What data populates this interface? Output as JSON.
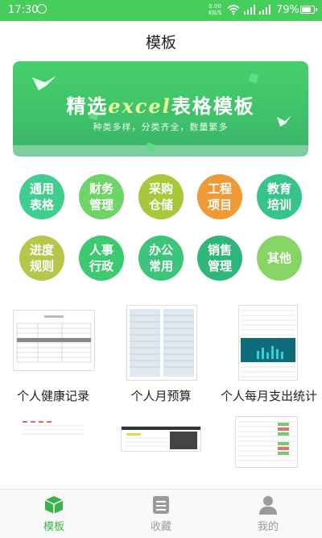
{
  "status": {
    "time": "17:30",
    "net_speed_num": "0.00",
    "net_speed_unit": "KB/S",
    "battery": "79%",
    "battery_level": 0.79
  },
  "header": {
    "title": "模板"
  },
  "banner": {
    "title_a": "精选",
    "title_b": "excel",
    "title_c": "表格模板",
    "subtitle": "种类多样，分类齐全，数量繁多"
  },
  "categories": [
    {
      "label": "通用\n表格",
      "color": "#3fce8d"
    },
    {
      "label": "财务\n管理",
      "color": "#6fd468"
    },
    {
      "label": "采购\n仓储",
      "color": "#a6c93b"
    },
    {
      "label": "工程\n项目",
      "color": "#f09a35"
    },
    {
      "label": "教育\n培训",
      "color": "#37c48b"
    },
    {
      "label": "进度\n规则",
      "color": "#b5c64a"
    },
    {
      "label": "人事\n行政",
      "color": "#3cc96f"
    },
    {
      "label": "办公\n常用",
      "color": "#3cc47a"
    },
    {
      "label": "销售\n管理",
      "color": "#2fb77a"
    },
    {
      "label": "其他",
      "color": "#86d565"
    }
  ],
  "templates": [
    {
      "label": "个人健康记录"
    },
    {
      "label": "个人月预算"
    },
    {
      "label": "个人每月支出统计"
    }
  ],
  "tabbar": {
    "items": [
      {
        "label": "模板",
        "icon": "cube-icon",
        "active": true
      },
      {
        "label": "收藏",
        "icon": "document-icon",
        "active": false
      },
      {
        "label": "我的",
        "icon": "person-icon",
        "active": false
      }
    ],
    "active_color": "#3ab34a",
    "inactive_color": "#9a9a9a"
  }
}
